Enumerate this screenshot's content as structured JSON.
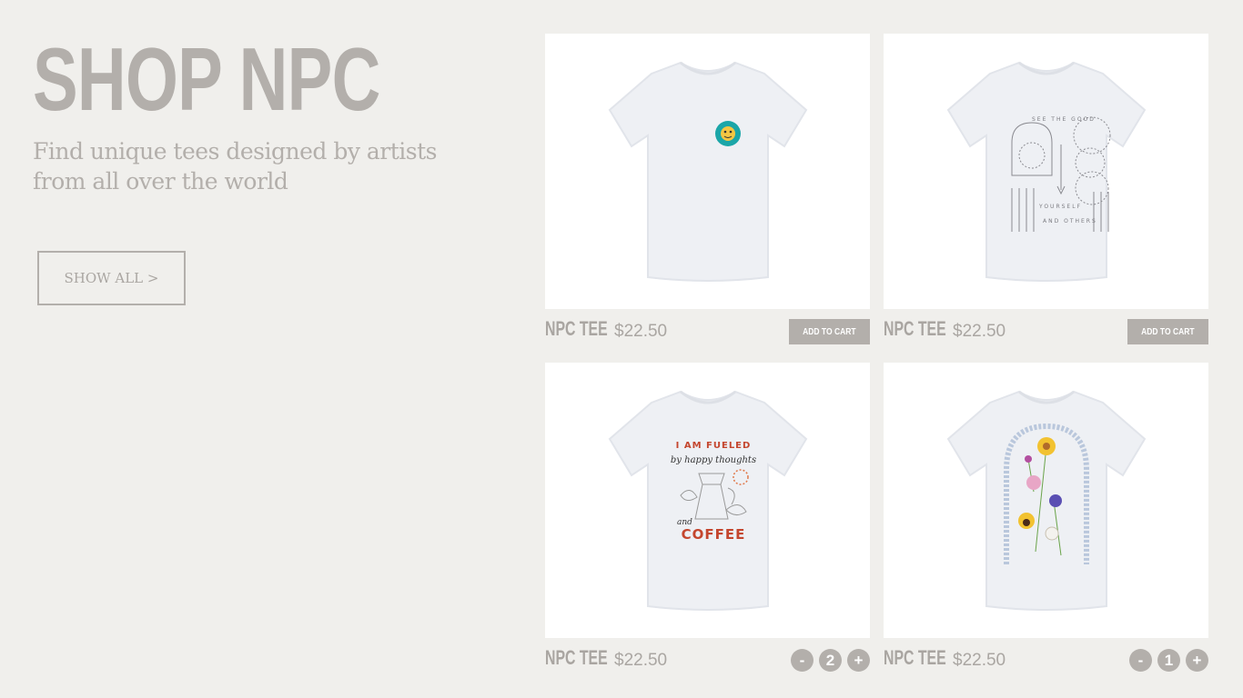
{
  "hero": {
    "title": "SHOP NPC",
    "subtitle": "Find unique tees designed by artists from all over the world",
    "show_all_label": "SHOW ALL >"
  },
  "colors": {
    "background": "#f0efec",
    "accent_gray": "#b3afab",
    "card_bg": "#ffffff"
  },
  "products": [
    {
      "name": "NPC TEE",
      "price": "$22.50",
      "action_label": "ADD TO CART",
      "design": "smiley-badge"
    },
    {
      "name": "NPC TEE",
      "price": "$22.50",
      "action_label": "ADD TO CART",
      "design": "see-the-good"
    },
    {
      "name": "NPC TEE",
      "price": "$22.50",
      "quantity": "2",
      "minus_label": "-",
      "plus_label": "+",
      "design": "fueled-coffee",
      "print": {
        "line1": "I AM FUELED",
        "line2": "by happy thoughts",
        "line3": "and",
        "line4": "COFFEE"
      }
    },
    {
      "name": "NPC TEE",
      "price": "$22.50",
      "quantity": "1",
      "minus_label": "-",
      "plus_label": "+",
      "design": "flowers"
    }
  ]
}
